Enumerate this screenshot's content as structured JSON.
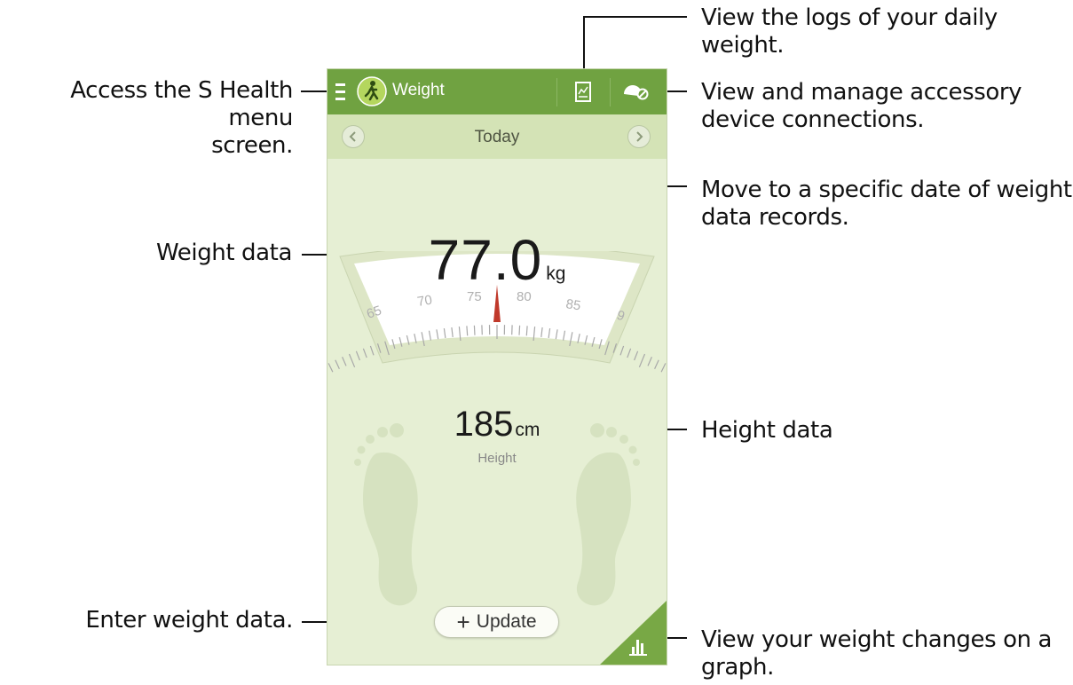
{
  "app": {
    "title": "Weight",
    "date_label": "Today",
    "weight_value": "77.0",
    "weight_unit": "kg",
    "height_value": "185",
    "height_unit": "cm",
    "height_label": "Height",
    "update_button": "Update",
    "update_plus": "+",
    "scale_ticks": [
      "65",
      "70",
      "75",
      "80",
      "85",
      "9"
    ],
    "colors": {
      "action_bar": "#70a241",
      "date_bar": "#d4e3b6",
      "background": "#e6efd4",
      "needle": "#c0392b"
    },
    "icons": [
      "menu-icon",
      "exercise-logo-icon",
      "log-chart-icon",
      "accessory-icon",
      "prev-arrow-icon",
      "next-arrow-icon",
      "graph-icon",
      "footprint-icon"
    ]
  },
  "callouts": {
    "menu": [
      "Access the S Health menu",
      "screen."
    ],
    "logs": [
      "View the logs of your daily",
      "weight."
    ],
    "accessory": [
      "View and manage accessory",
      "device connections."
    ],
    "date": [
      "Move to a specific date of weight",
      "data records."
    ],
    "weight": [
      "Weight data"
    ],
    "height": [
      "Height data"
    ],
    "enter": [
      "Enter weight data."
    ],
    "graph": [
      "View your weight changes on a",
      "graph."
    ]
  }
}
